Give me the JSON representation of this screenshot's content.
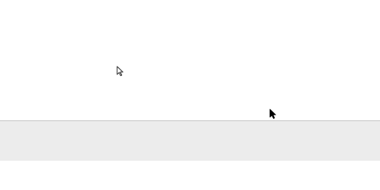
{
  "colors": {
    "background": "#ffffff",
    "bottom_panel": "#ececec",
    "divider": "#c8c8c8"
  },
  "icons": {
    "cursor_outline": "arrow-pointer-outline-icon",
    "cursor_solid": "arrow-pointer-icon"
  }
}
